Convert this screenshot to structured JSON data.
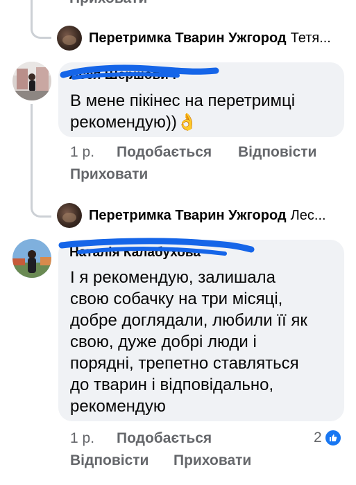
{
  "top_cut": {
    "label": "Приховати"
  },
  "reply1": {
    "page_name": "Перетримка Тварин Ужгород",
    "preview": "Тетя..."
  },
  "comment1": {
    "author": "Лєся Шершович",
    "text_lines": [
      "В мене пікінес на перетримці",
      "рекомендую))👌"
    ],
    "time": "1 р.",
    "like": "Подобається",
    "reply": "Відповісти",
    "hide": "Приховати"
  },
  "reply2": {
    "page_name": "Перетримка Тварин Ужгород",
    "preview": "Лес..."
  },
  "comment2": {
    "author": "Наталія Калабухова",
    "text_lines": [
      "І я рекомендую, залишала",
      "свою собачку на три місяці,",
      "добре доглядали, любили її як",
      "свою, дуже добрі люди і",
      "порядні, трепетно ставляться",
      "до тварин і відповідально,",
      "рекомендую"
    ],
    "time": "1 р.",
    "like": "Подобається",
    "reaction_count": "2",
    "reply": "Відповісти",
    "hide": "Приховати"
  },
  "colors": {
    "bubble": "#f0f2f5",
    "meta_text": "#65676b",
    "scribble": "#1565e8",
    "like_blue": "#1877f2"
  }
}
